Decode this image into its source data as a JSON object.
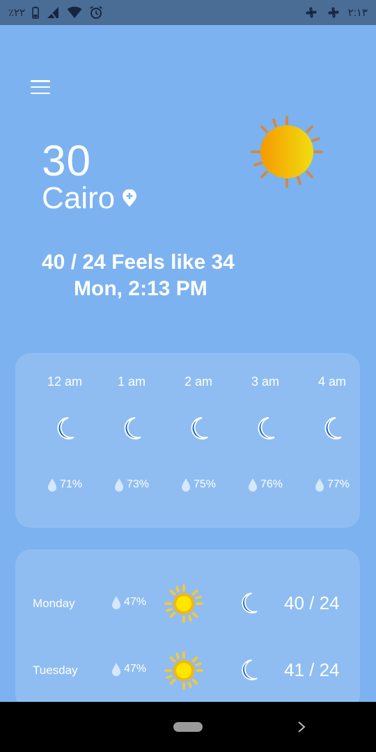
{
  "status_bar": {
    "battery": "٪٢٢",
    "time": "٢:١٣",
    "icons": [
      "battery-icon",
      "no-sim-icon",
      "wifi-icon",
      "alarm-icon",
      "fan-icon",
      "fan-icon"
    ]
  },
  "current": {
    "temperature": "30",
    "city": "Cairo",
    "minmax_feels": "40 / 24 Feels like 34",
    "datetime": "Mon, 2:13 PM",
    "condition_icon": "sun-icon"
  },
  "hourly": [
    {
      "time": "12 am",
      "icon": "moon-icon",
      "humidity": "71%"
    },
    {
      "time": "1 am",
      "icon": "moon-icon",
      "humidity": "73%"
    },
    {
      "time": "2 am",
      "icon": "moon-icon",
      "humidity": "75%"
    },
    {
      "time": "3 am",
      "icon": "moon-icon",
      "humidity": "76%"
    },
    {
      "time": "4 am",
      "icon": "moon-icon",
      "humidity": "77%"
    }
  ],
  "daily": [
    {
      "day": "Monday",
      "humidity": "47%",
      "day_icon": "sun-icon",
      "night_icon": "moon-icon",
      "temps": "40 / 24"
    },
    {
      "day": "Tuesday",
      "humidity": "47%",
      "day_icon": "sun-icon",
      "night_icon": "moon-icon",
      "temps": "41 / 24"
    }
  ],
  "colors": {
    "background": "#7cb2f0",
    "status_bar": "#4a6d96",
    "moon": "#1565c0",
    "sun": "#ffd60a",
    "drop": "#d6e8fb"
  }
}
